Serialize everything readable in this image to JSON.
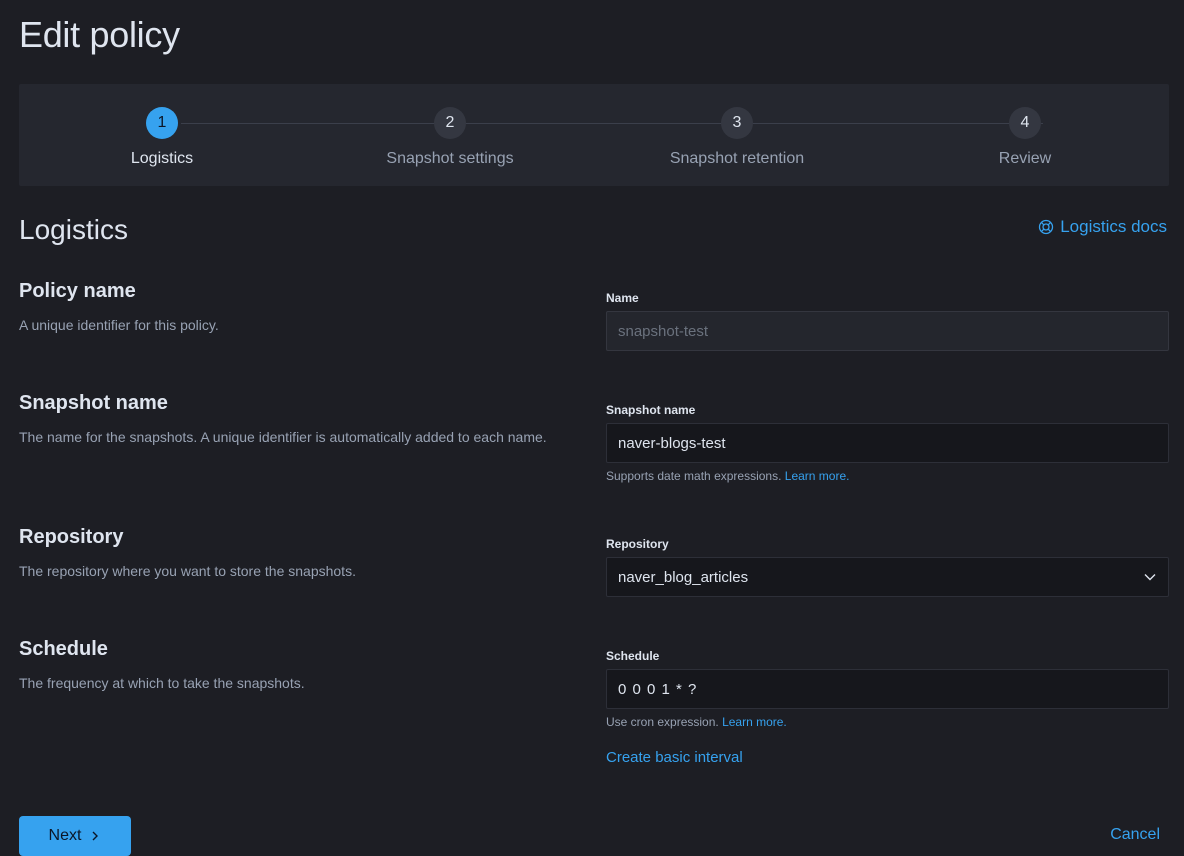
{
  "page": {
    "title": "Edit policy"
  },
  "steps": [
    {
      "number": "1",
      "label": "Logistics",
      "current": true
    },
    {
      "number": "2",
      "label": "Snapshot settings",
      "current": false
    },
    {
      "number": "3",
      "label": "Snapshot retention",
      "current": false
    },
    {
      "number": "4",
      "label": "Review",
      "current": false
    }
  ],
  "section": {
    "title": "Logistics",
    "docs_link": "Logistics docs",
    "docs_icon": "lifebuoy-icon"
  },
  "policy_name": {
    "title": "Policy name",
    "description": "A unique identifier for this policy.",
    "label": "Name",
    "value": "snapshot-test"
  },
  "snapshot_name": {
    "title": "Snapshot name",
    "description": "The name for the snapshots. A unique identifier is automatically added to each name.",
    "label": "Snapshot name",
    "value": "naver-blogs-test",
    "help_text": "Supports date math expressions.",
    "help_link": "Learn more."
  },
  "repository": {
    "title": "Repository",
    "description": "The repository where you want to store the snapshots.",
    "label": "Repository",
    "value": "naver_blog_articles",
    "icon": "chevron-down-icon"
  },
  "schedule": {
    "title": "Schedule",
    "description": "The frequency at which to take the snapshots.",
    "label": "Schedule",
    "value": "0 0 0 1 * ?",
    "help_text": "Use cron expression.",
    "help_link": "Learn more.",
    "basic_interval": "Create basic interval"
  },
  "footer": {
    "next_label": "Next",
    "cancel_label": "Cancel"
  },
  "colors": {
    "background": "#1d1e24",
    "panel": "#25272f",
    "accent": "#36a2ef",
    "text": "#dfe5ef",
    "subdued": "#98a2b3"
  }
}
